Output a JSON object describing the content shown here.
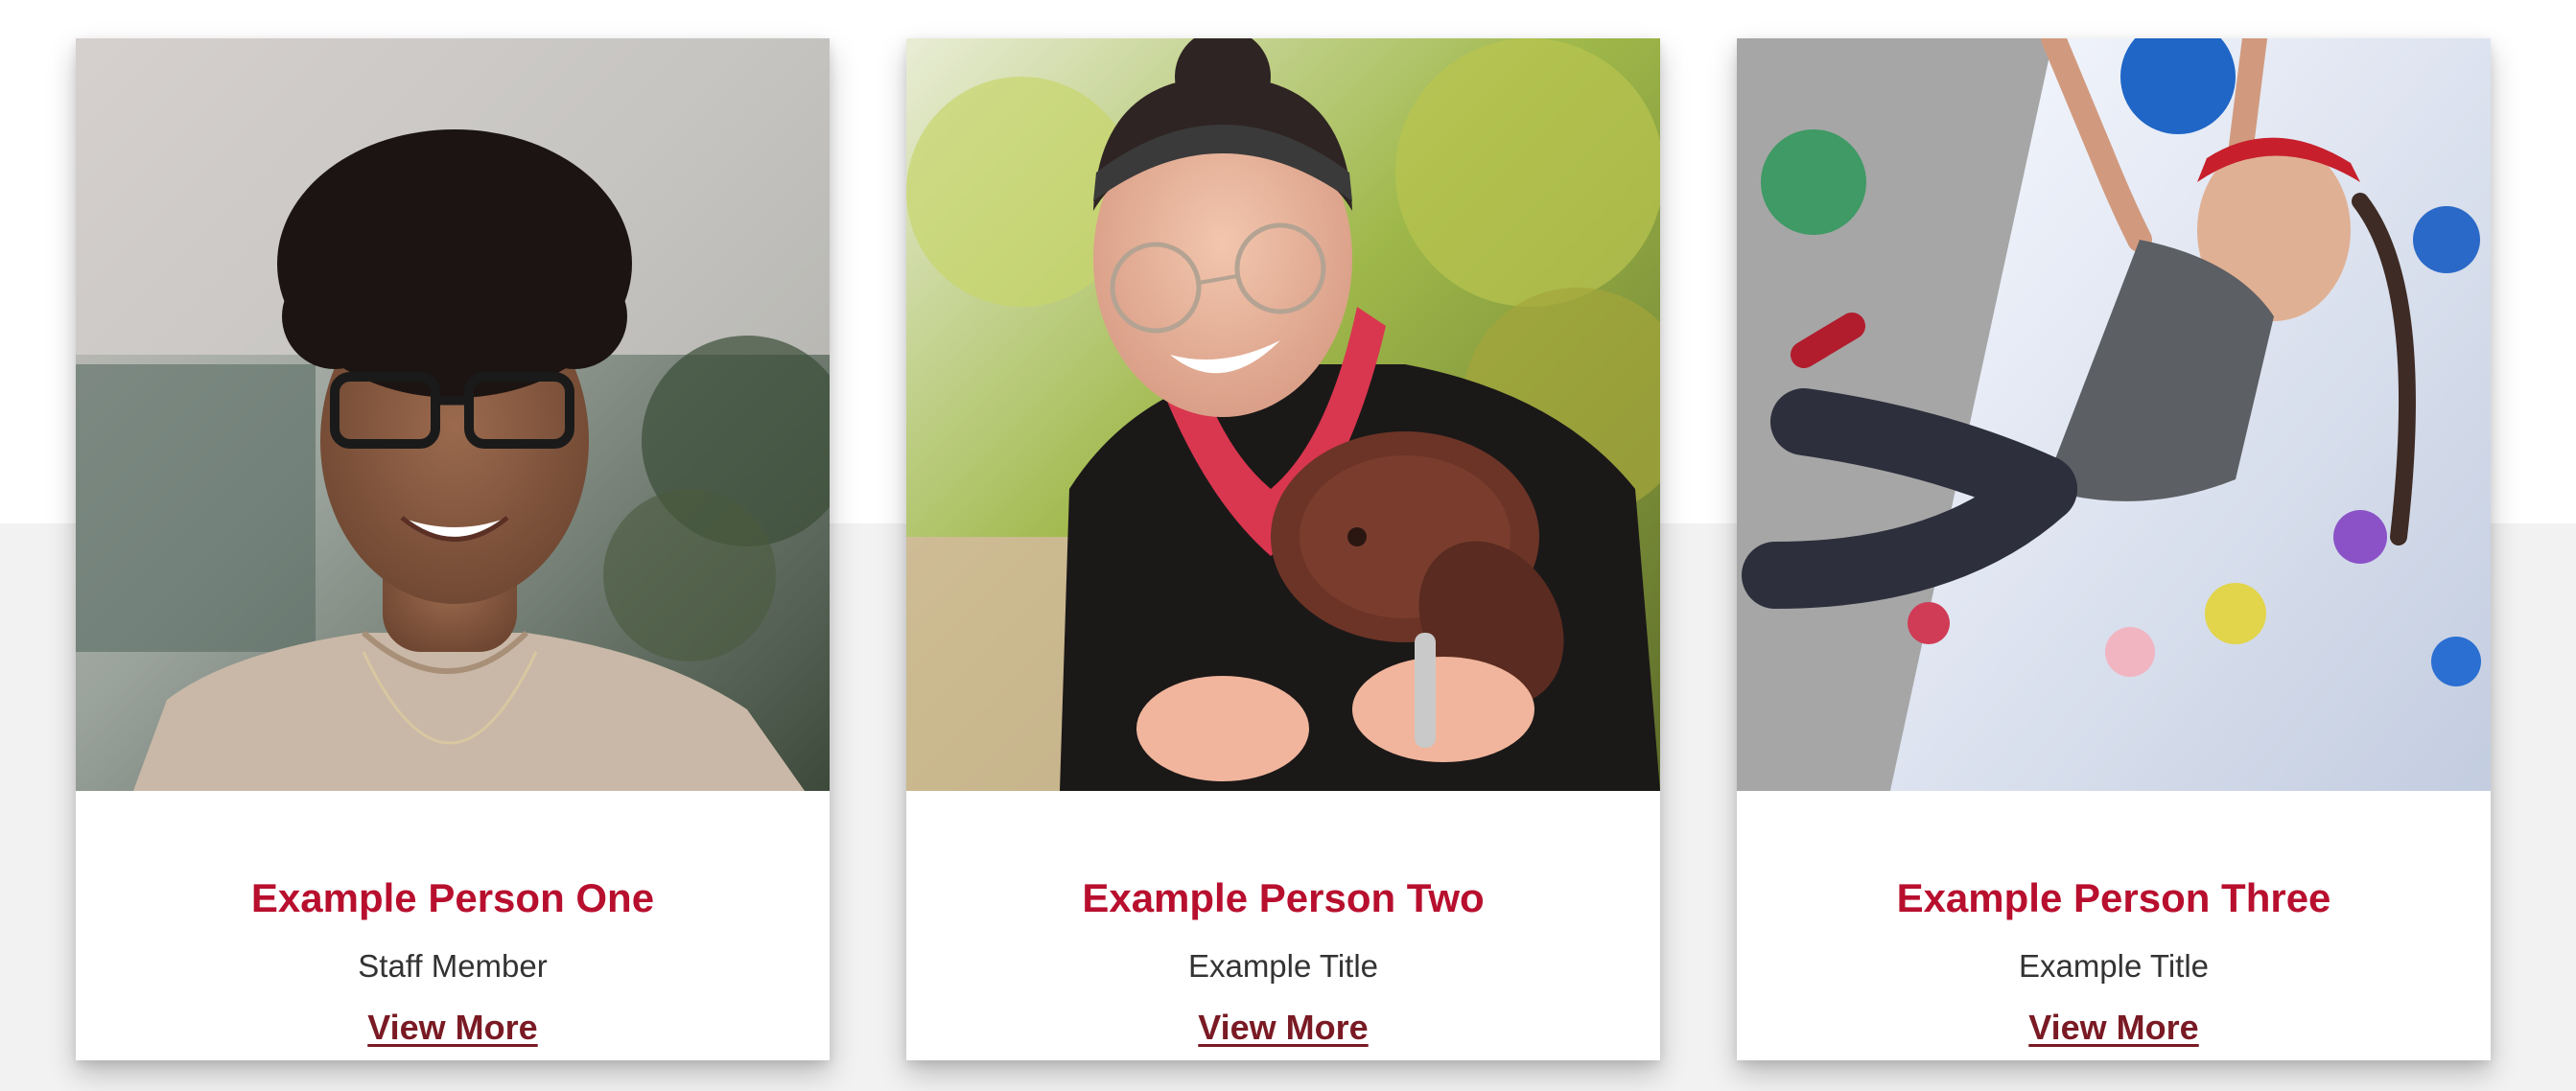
{
  "cards": [
    {
      "name": "Example Person One",
      "title": "Staff Member",
      "link_label": "View More",
      "photo": "portrait-woman-glasses"
    },
    {
      "name": "Example Person Two",
      "title": "Example Title",
      "link_label": "View More",
      "photo": "woman-with-puppy"
    },
    {
      "name": "Example Person Three",
      "title": "Example Title",
      "link_label": "View More",
      "photo": "woman-rock-climbing"
    }
  ],
  "colors": {
    "name": "#b80f2e",
    "link": "#7a1a24",
    "band": "#f2f2f2"
  }
}
